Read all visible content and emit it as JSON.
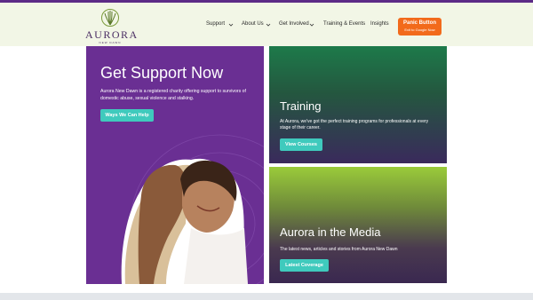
{
  "header": {
    "logo_word": "AURORA",
    "logo_sub": "NEW DAWN",
    "nav": [
      {
        "label": "Support",
        "has_dropdown": true
      },
      {
        "label": "About Us",
        "has_dropdown": true
      },
      {
        "label": "Get Involved",
        "has_dropdown": true
      },
      {
        "label": "Training & Events",
        "has_dropdown": false
      },
      {
        "label": "Insights",
        "has_dropdown": false
      }
    ],
    "panic": {
      "title": "Panic Button",
      "subtitle": "Exit to Google Now"
    }
  },
  "support_card": {
    "title": "Get Support Now",
    "body": "Aurora New Dawn is a registered charity offering support to survivors of domestic abuse, sexual violence and stalking.",
    "button": "Ways We Can Help"
  },
  "training_card": {
    "title": "Training",
    "body": "At Aurora, we've got the perfect training programs for professionals at every stage of their career.",
    "button": "View Courses"
  },
  "media_card": {
    "title": "Aurora in the Media",
    "body": "The latest news, articles and stories from Aurora New Dawn",
    "button": "Latest Coverage"
  },
  "colors": {
    "brand_purple": "#6a2f93",
    "teal": "#3fcabd",
    "panic_orange": "#f26a1b",
    "header_bg": "#f2f6e6"
  },
  "icons": [
    "aurora-logo-icon",
    "chevron-down-icon"
  ]
}
